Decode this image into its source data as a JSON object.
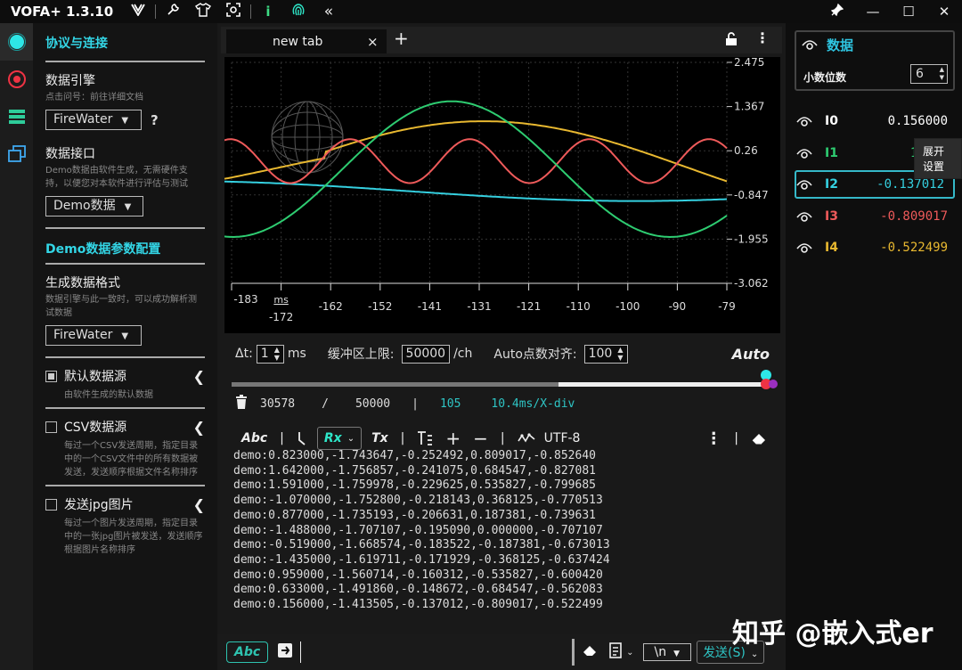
{
  "app": {
    "title": "VOFA+ 1.3.10"
  },
  "sidebar": {
    "section_protocol": "协议与连接",
    "engine_label": "数据引擎",
    "engine_hint": "点击问号：前往详细文档",
    "engine_value": "FireWater",
    "engine_help": "?",
    "interface_label": "数据接口",
    "interface_hint": "Demo数据由软件生成，无需硬件支持，以便您对本软件进行评估与测试",
    "interface_value": "Demo数据",
    "section_demo": "Demo数据参数配置",
    "format_label": "生成数据格式",
    "format_hint": "数据引擎与此一致时，可以成功解析测试数据",
    "format_value": "FireWater",
    "sources": [
      {
        "label": "默认数据源",
        "hint": "由软件生成的默认数据",
        "checked": true
      },
      {
        "label": "CSV数据源",
        "hint": "每过一个CSV发送周期，指定目录中的一个CSV文件中的所有数据被发送，发送顺序根据文件名称排序",
        "checked": false
      },
      {
        "label": "发送jpg图片",
        "hint": "每过一个图片发送周期，指定目录中的一张jpg图片被发送，发送顺序根据图片名称排序",
        "checked": false
      }
    ]
  },
  "tabs": {
    "active": "new tab",
    "close": "×",
    "add": "+"
  },
  "plot": {
    "y_ticks": [
      "2.475",
      "1.367",
      "0.26",
      "-0.847",
      "-1.955",
      "-3.062"
    ],
    "x_ticks": [
      "-183",
      "-172",
      "-162",
      "-152",
      "-141",
      "-131",
      "-121",
      "-110",
      "-100",
      "-90",
      "-79"
    ],
    "x_unit": "ms"
  },
  "controls": {
    "dt_label": "Δt:",
    "dt_value": "1",
    "dt_unit": "ms",
    "buffer_label": "缓冲区上限:",
    "buffer_value": "50000",
    "buffer_unit": "/ch",
    "align_label": "Auto点数对齐:",
    "align_value": "100",
    "auto_label": "Auto"
  },
  "status": {
    "count": "30578",
    "slash": "/",
    "limit": "50000",
    "bar": "|",
    "points": "105",
    "div": "10.4ms/X-div",
    "buffer_fill": 0.6116
  },
  "toolbar": {
    "abc": "Abc",
    "rx": "Rx",
    "tx": "Tx",
    "plus": "+",
    "minus": "−",
    "encoding": "UTF-8"
  },
  "log": [
    "demo:0.823000,-1.743647,-0.252492,0.809017,-0.852640",
    "demo:1.642000,-1.756857,-0.241075,0.684547,-0.827081",
    "demo:1.591000,-1.759978,-0.229625,0.535827,-0.799685",
    "demo:-1.070000,-1.752800,-0.218143,0.368125,-0.770513",
    "demo:0.877000,-1.735193,-0.206631,0.187381,-0.739631",
    "demo:-1.488000,-1.707107,-0.195090,0.000000,-0.707107",
    "demo:-0.519000,-1.668574,-0.183522,-0.187381,-0.673013",
    "demo:-1.435000,-1.619711,-0.171929,-0.368125,-0.637424",
    "demo:0.959000,-1.560714,-0.160312,-0.535827,-0.600420",
    "demo:0.633000,-1.491860,-0.148672,-0.684547,-0.562083",
    "demo:0.156000,-1.413505,-0.137012,-0.809017,-0.522499"
  ],
  "sendbar": {
    "abc": "Abc",
    "newline": "\\n",
    "send": "发送(S)"
  },
  "right": {
    "title": "数据",
    "decimals_label": "小数位数",
    "decimals_value": "6",
    "tooltip": "展开设置",
    "channels": [
      {
        "name": "I0",
        "value": "0.156000",
        "color": "#ffffff"
      },
      {
        "name": "I1",
        "value": "13505",
        "color": "#2ecc71"
      },
      {
        "name": "I2",
        "value": "-0.137012",
        "color": "#35d0e0"
      },
      {
        "name": "I3",
        "value": "-0.809017",
        "color": "#ee5a5a"
      },
      {
        "name": "I4",
        "value": "-0.522499",
        "color": "#e8b830"
      }
    ]
  },
  "watermark": "知乎 @嵌入式er"
}
